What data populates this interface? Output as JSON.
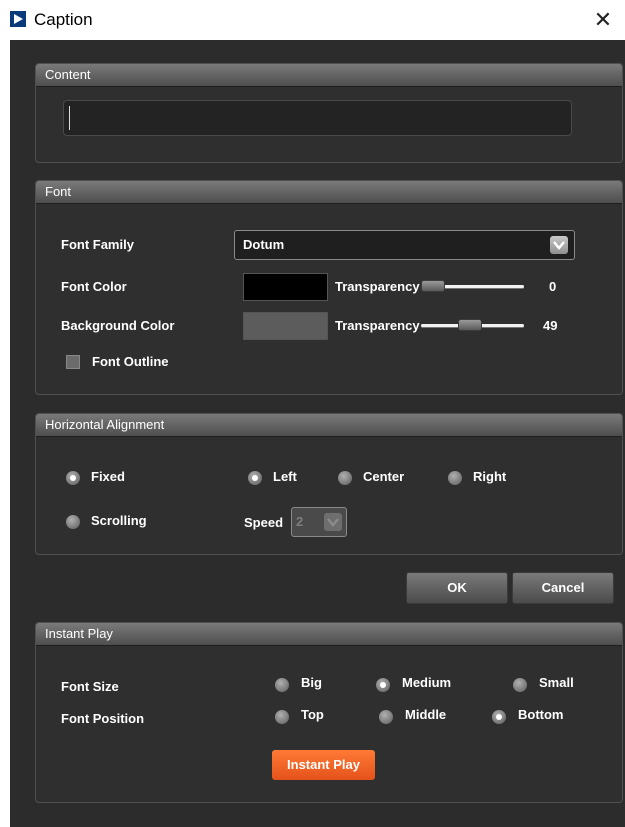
{
  "window": {
    "title": "Caption",
    "close_glyph": "✕"
  },
  "content": {
    "header": "Content",
    "text_value": ""
  },
  "font": {
    "header": "Font",
    "family_label": "Font Family",
    "family_value": "Dotum",
    "color_label": "Font Color",
    "color_value": "#000000",
    "color_transparency_label": "Transparency",
    "color_transparency_value": "0",
    "bg_label": "Background Color",
    "bg_value": "#5c5c5c",
    "bg_transparency_label": "Transparency",
    "bg_transparency_value": "49",
    "outline_label": "Font Outline",
    "outline_checked": false
  },
  "horizontal_alignment": {
    "header": "Horizontal Alignment",
    "mode_fixed": "Fixed",
    "mode_scrolling": "Scrolling",
    "selected_mode": "Fixed",
    "align_left": "Left",
    "align_center": "Center",
    "align_right": "Right",
    "selected_align": "Left",
    "speed_label": "Speed",
    "speed_value": "2"
  },
  "actions": {
    "ok_label": "OK",
    "cancel_label": "Cancel"
  },
  "instant_play": {
    "header": "Instant Play",
    "size_label": "Font Size",
    "size_big": "Big",
    "size_medium": "Medium",
    "size_small": "Small",
    "selected_size": "Medium",
    "position_label": "Font Position",
    "pos_top": "Top",
    "pos_middle": "Middle",
    "pos_bottom": "Bottom",
    "selected_position": "Bottom",
    "play_label": "Instant Play"
  },
  "colors": {
    "background": "#2c2c2c",
    "panel_header": "#6a6a6a",
    "accent_orange": "#f0602a",
    "titlebar_icon": "#0a3a78"
  },
  "icons": {
    "app": "play-triangle-icon",
    "close": "close-icon",
    "dropdown": "chevron-down-icon"
  }
}
